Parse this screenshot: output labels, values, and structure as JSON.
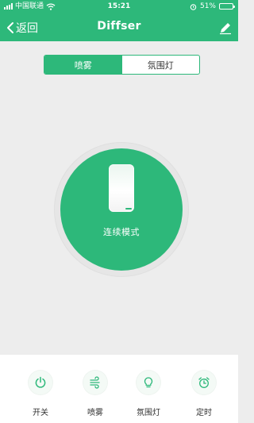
{
  "colors": {
    "accent": "#2db87a",
    "background": "#ededed"
  },
  "status_bar": {
    "carrier": "中国联通",
    "time": "15:21",
    "battery_percent": 51,
    "battery_label": "51%"
  },
  "nav": {
    "back_label": "返回",
    "title": "Diffser",
    "edit_icon": "pencil-icon"
  },
  "segment": {
    "items": [
      {
        "label": "喷雾",
        "active": true
      },
      {
        "label": "氛围灯",
        "active": false
      }
    ]
  },
  "dial": {
    "mode_label": "连续模式",
    "icon": "diffuser-device-icon"
  },
  "bottom_bar": {
    "items": [
      {
        "label": "开关",
        "icon": "power-icon"
      },
      {
        "label": "喷雾",
        "icon": "mist-icon"
      },
      {
        "label": "氛围灯",
        "icon": "bulb-icon"
      },
      {
        "label": "定时",
        "icon": "alarm-clock-icon"
      }
    ]
  }
}
